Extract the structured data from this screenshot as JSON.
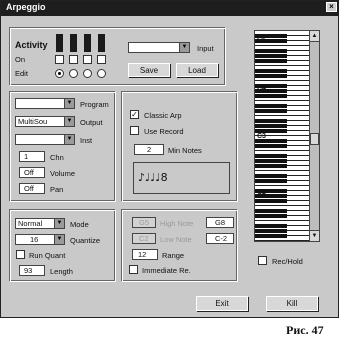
{
  "window": {
    "title": "Arpeggio",
    "close_glyph": "×"
  },
  "activity": {
    "label": "Activity",
    "on_label": "On",
    "edit_label": "Edit",
    "selected_edit": 0,
    "input_label": "Input",
    "save_label": "Save",
    "load_label": "Load",
    "input_value": ""
  },
  "output": {
    "program_label": "Program",
    "program_value": "",
    "output_label": "Output",
    "output_value": "MultiSou",
    "inst_label": "Inst",
    "inst_value": "",
    "chn_label": "Chn",
    "chn_value": "1",
    "volume_label": "Volume",
    "volume_value": "Off",
    "pan_label": "Pan",
    "pan_value": "Off"
  },
  "arp": {
    "classic_label": "Classic Arp",
    "classic_checked": true,
    "record_label": "Use Record",
    "record_checked": false,
    "minnotes_label": "Min Notes",
    "minnotes_value": "2",
    "notes_display": "♪♩♩♩8"
  },
  "mode": {
    "mode_label": "Mode",
    "mode_value": "Normal",
    "quantize_label": "Quantize",
    "quantize_value": "16",
    "runquant_label": "Run Quant",
    "length_label": "Length",
    "length_value": "93"
  },
  "range": {
    "high_label": "High Note",
    "high_left": "G5",
    "high_right": "G8",
    "low_label": "Low Note",
    "low_left": "C2",
    "low_right": "C-2",
    "range_label": "Range",
    "range_value": "12",
    "immediate_label": "Immediate Re."
  },
  "keyboard": {
    "octave_labels": [
      "C5",
      "C4",
      "C3",
      "C2"
    ],
    "rechold_label": "Rec/Hold"
  },
  "footer": {
    "exit_label": "Exit",
    "kill_label": "Kill"
  },
  "caption": "Рис. 47",
  "icons": {
    "dropdown": "▼",
    "scroll_up": "▲",
    "scroll_down": "▼",
    "check": "✓"
  }
}
